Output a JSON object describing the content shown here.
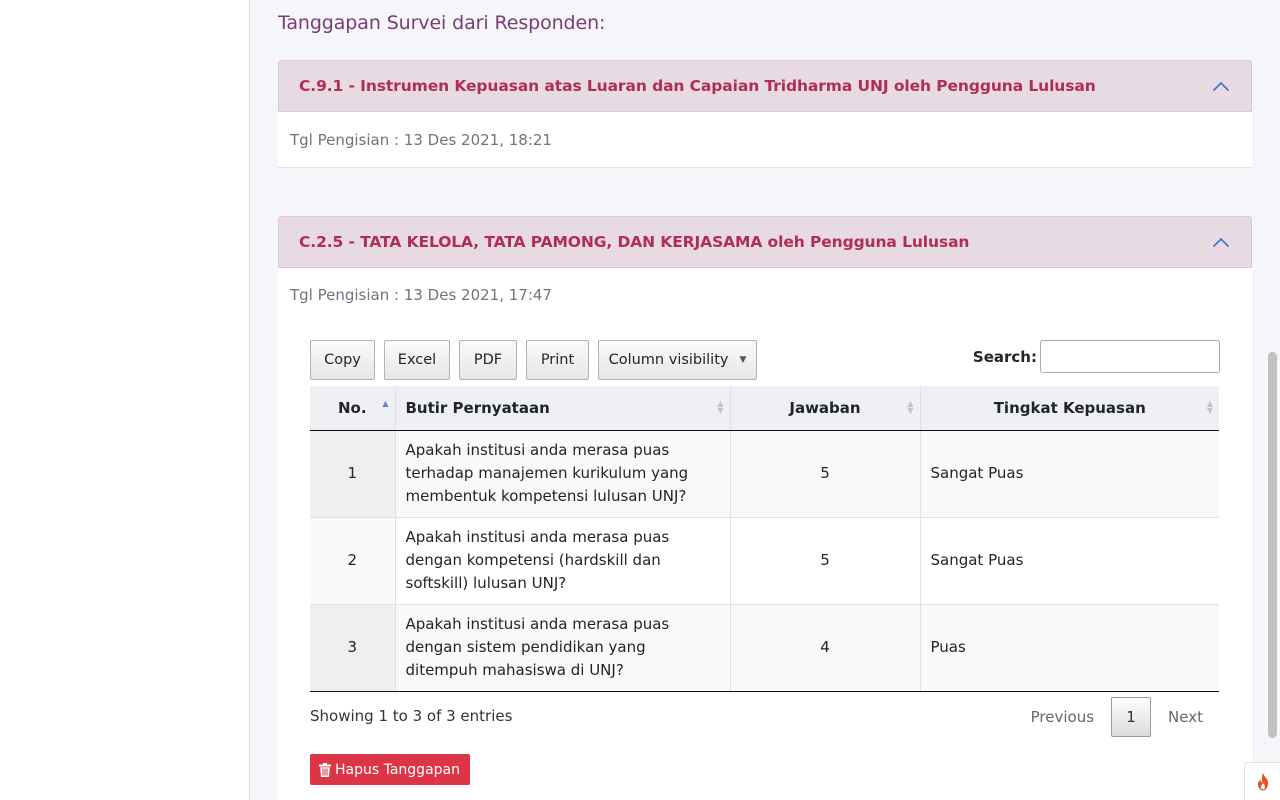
{
  "page": {
    "heading": "Tanggapan Survei dari Responden:"
  },
  "cards": [
    {
      "title": "C.9.1 - Instrumen Kepuasan atas Luaran dan Capaian Tridharma UNJ oleh Pengguna Lulusan",
      "tgl": "Tgl Pengisian : 13 Des 2021, 18:21"
    },
    {
      "title": "C.2.5 - TATA KELOLA, TATA PAMONG, DAN KERJASAMA oleh Pengguna Lulusan",
      "tgl": "Tgl Pengisian : 13 Des 2021, 17:47"
    }
  ],
  "toolbar": {
    "copy": "Copy",
    "excel": "Excel",
    "pdf": "PDF",
    "print": "Print",
    "column_visibility": "Column visibility"
  },
  "search": {
    "label": "Search:",
    "value": ""
  },
  "table": {
    "headers": [
      "No.",
      "Butir Pernyataan",
      "Jawaban",
      "Tingkat Kepuasan"
    ],
    "rows": [
      {
        "no": "1",
        "butir": "Apakah institusi anda merasa puas terhadap manajemen kurikulum yang membentuk kompetensi lulusan UNJ?",
        "jawaban": "5",
        "tingkat": "Sangat Puas"
      },
      {
        "no": "2",
        "butir": "Apakah institusi anda merasa puas dengan kompetensi (hardskill dan softskill) lulusan UNJ?",
        "jawaban": "5",
        "tingkat": "Sangat Puas"
      },
      {
        "no": "3",
        "butir": "Apakah institusi anda merasa puas dengan sistem pendidikan yang ditempuh mahasiswa di UNJ?",
        "jawaban": "4",
        "tingkat": "Puas"
      }
    ]
  },
  "info": "Showing 1 to 3 of 3 entries",
  "pagination": {
    "previous": "Previous",
    "current": "1",
    "next": "Next"
  },
  "delete_button": "Hapus Tanggapan",
  "colors": {
    "heading": "#7b3b76",
    "card_title": "#b02e56",
    "card_header_bg": "#e8dae2",
    "danger": "#dc3545"
  },
  "icons": {
    "collapse": "chevron-up-icon",
    "delete": "trash-icon",
    "corner": "flame-icon"
  }
}
